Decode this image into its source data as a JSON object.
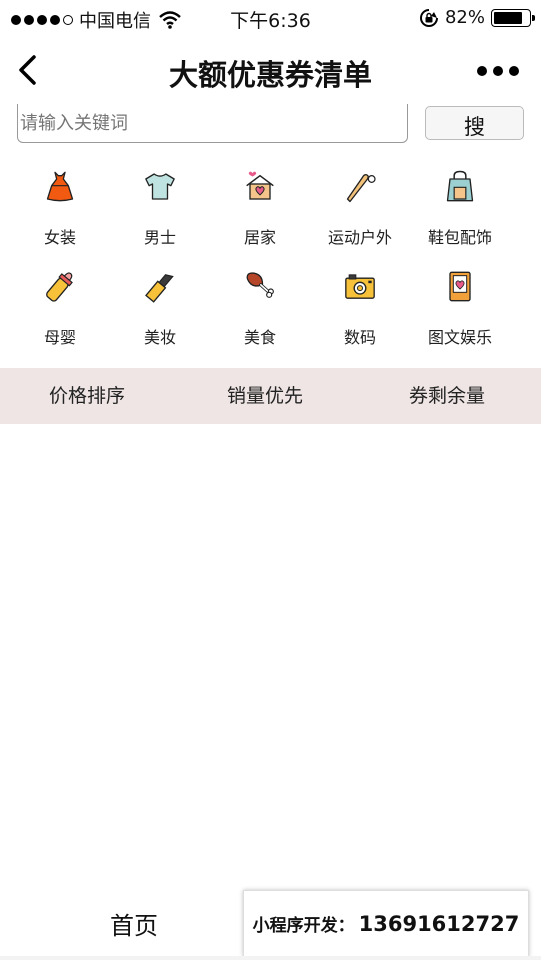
{
  "status_bar": {
    "carrier": "中国电信",
    "time": "下午6:36",
    "battery_percent": "82%",
    "battery_level": 0.82
  },
  "nav": {
    "title": "大额优惠券清单",
    "back_icon": "chevron-left-icon",
    "more_icon": "more-dots-icon"
  },
  "search": {
    "placeholder": "请输入关键词",
    "button_label": "搜"
  },
  "categories": [
    {
      "label": "女装",
      "icon": "dress-icon"
    },
    {
      "label": "男士",
      "icon": "tshirt-icon"
    },
    {
      "label": "居家",
      "icon": "house-icon"
    },
    {
      "label": "运动户外",
      "icon": "baseball-bat-icon"
    },
    {
      "label": "鞋包配饰",
      "icon": "bag-icon"
    },
    {
      "label": "母婴",
      "icon": "baby-bottle-icon"
    },
    {
      "label": "美妆",
      "icon": "lipstick-icon"
    },
    {
      "label": "美食",
      "icon": "drumstick-icon"
    },
    {
      "label": "数码",
      "icon": "camera-icon"
    },
    {
      "label": "图文娱乐",
      "icon": "book-icon"
    }
  ],
  "sort": {
    "price": "价格排序",
    "sales": "销量优先",
    "remaining": "券剩余量"
  },
  "tabbar": {
    "home": "首页"
  },
  "dev_banner": {
    "label": "小程序开发：",
    "phone": "13691612727"
  },
  "colors": {
    "sort_bar_bg": "#eee5e4",
    "accent_orange": "#f05a1a"
  }
}
